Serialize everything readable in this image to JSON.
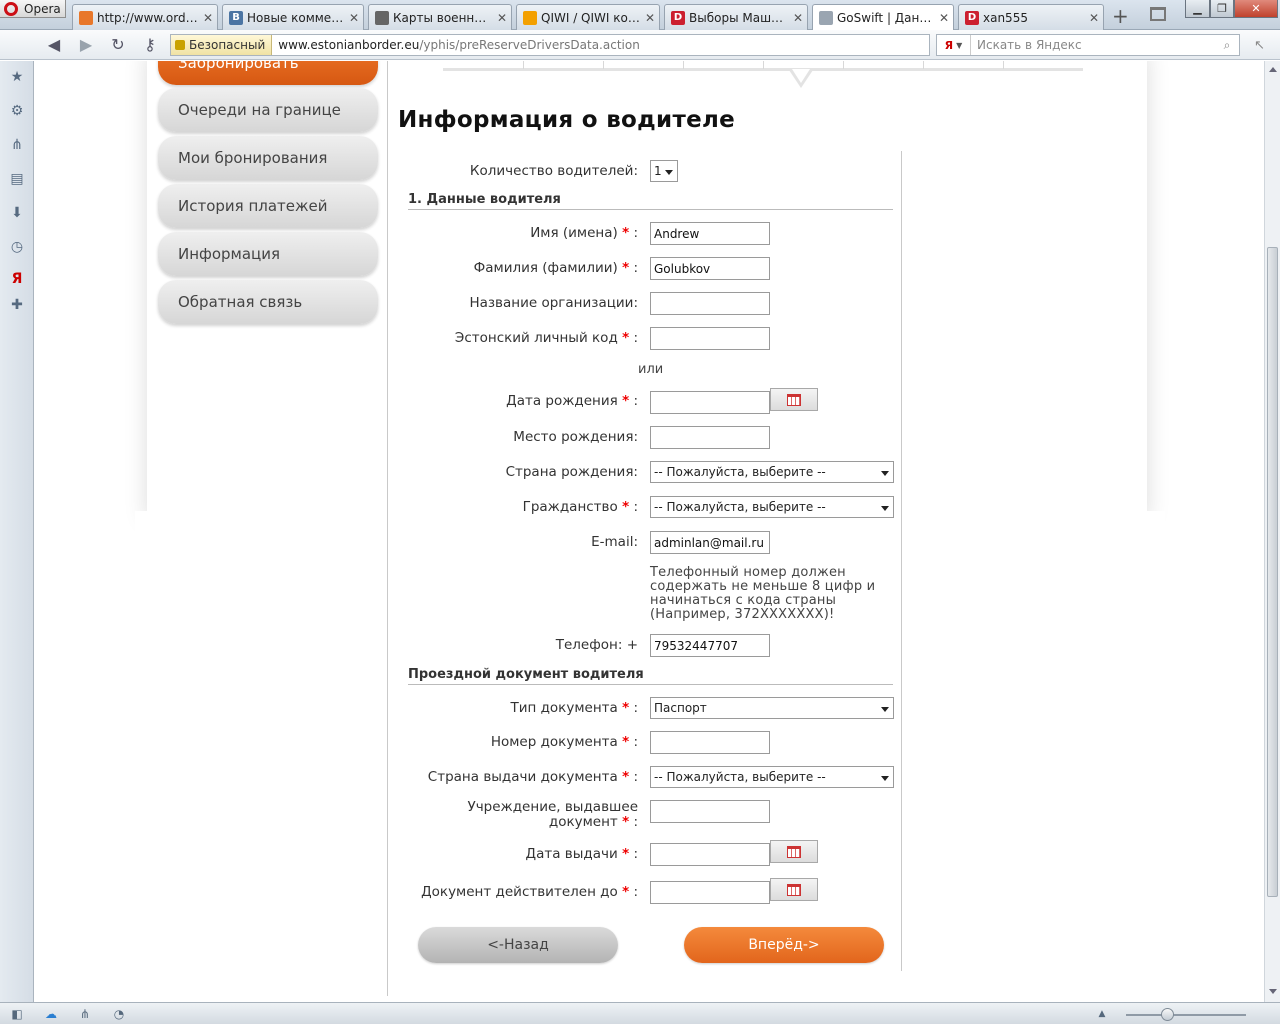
{
  "browser": {
    "app_button": "Opera",
    "tabs": [
      {
        "title": "http://www.ordi.e...",
        "favicon": "ordi-favicon",
        "color": "#e8772a",
        "letter": "",
        "active": false
      },
      {
        "title": "Новые коммента...",
        "favicon": "vk-favicon",
        "color": "#4c75a3",
        "letter": "B",
        "active": false
      },
      {
        "title": "Карты военных о...",
        "favicon": "map-favicon",
        "color": "#666666",
        "letter": "",
        "active": false
      },
      {
        "title": "QIWI / QIWI коше...",
        "favicon": "qiwi-favicon",
        "color": "#f3a000",
        "letter": "",
        "active": false
      },
      {
        "title": "Выборы Машин...",
        "favicon": "d-favicon",
        "color": "#cc1f2f",
        "letter": "D",
        "active": false
      },
      {
        "title": "GoSwift | Данные...",
        "favicon": "goswift-favicon",
        "color": "#9aa5b1",
        "letter": "",
        "active": true
      },
      {
        "title": "xan555",
        "favicon": "d-favicon",
        "color": "#cc1f2f",
        "letter": "D",
        "active": false
      }
    ],
    "security_label": "Безопасный",
    "url_host": "www.estonianborder.eu",
    "url_path": "/yphis/preReserveDriversData.action",
    "search_engine": "Я",
    "search_placeholder": "Искать в Яндекс"
  },
  "left_nav": {
    "items": [
      {
        "label": "Забронировать",
        "style": "orange"
      },
      {
        "label": "Очереди на границе"
      },
      {
        "label": "Мои бронирования"
      },
      {
        "label": "История платежей"
      },
      {
        "label": "Информация"
      },
      {
        "label": "Обратная связь"
      }
    ]
  },
  "form": {
    "title": "Информация о водителе",
    "driver_count_label": "Количество водителей:",
    "driver_count_value": "1",
    "section1_title": "1. Данные водителя",
    "first_name_label": "Имя (имена)",
    "first_name_value": "Andrew",
    "last_name_label": "Фамилия (фамилии)",
    "last_name_value": "Golubkov",
    "org_label": "Название организации:",
    "org_value": "",
    "personal_code_label": "Эстонский личный код",
    "personal_code_value": "",
    "or_text": "или",
    "birth_date_label": "Дата рождения",
    "birth_date_value": "",
    "birth_place_label": "Место рождения:",
    "birth_place_value": "",
    "birth_country_label": "Страна рождения:",
    "birth_country_value": "-- Пожалуйста, выберите --",
    "citizenship_label": "Гражданство",
    "citizenship_value": "-- Пожалуйста, выберите --",
    "email_label": "E-mail:",
    "email_value": "adminlan@mail.ru",
    "phone_note": "Телефонный номер должен содержать не меньше 8 цифр и начинаться с кода страны (Например, 372XXXXXXX)!",
    "phone_label": "Телефон: +",
    "phone_value": "79532447707",
    "section2_title": "Проездной документ водителя",
    "doc_type_label": "Тип документа",
    "doc_type_value": "Паспорт",
    "doc_number_label": "Номер документа",
    "doc_number_value": "",
    "doc_country_label": "Страна выдачи документа",
    "doc_country_value": "-- Пожалуйста, выберите --",
    "issuer_label": "Учреждение, выдавшее документ",
    "issuer_value": "",
    "issue_date_label": "Дата выдачи",
    "issue_date_value": "",
    "valid_until_label": "Документ действителен до",
    "valid_until_value": "",
    "required_mark": "*",
    "colon": ":",
    "back_button": "<-Назад",
    "next_button": "Вперёд->"
  },
  "colors": {
    "accent_orange": "#e8772a",
    "required_red": "#e00000",
    "nav_gray": "#d6d6d6"
  }
}
